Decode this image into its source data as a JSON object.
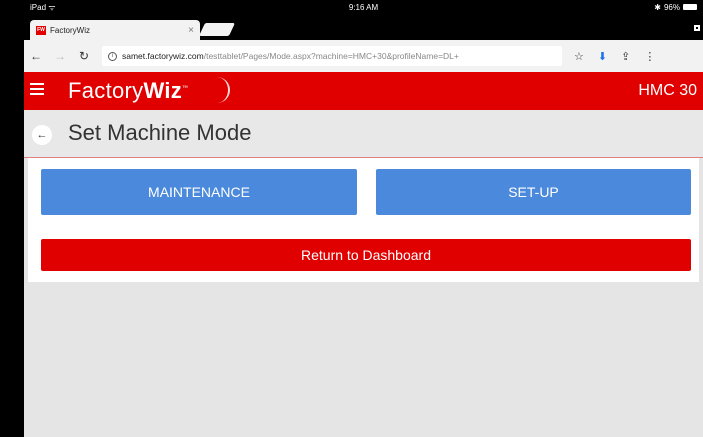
{
  "statusbar": {
    "device": "iPad",
    "wifi_icon": "wifi-icon",
    "time": "9:16 AM",
    "battery": "96%"
  },
  "browser": {
    "tab_title": "FactoryWiz",
    "favicon_text": "FW",
    "tab_close": "×",
    "url_host": "samet.factorywiz.com",
    "url_path": "/testtablet/Pages/Mode.aspx?machine=HMC+30&profileName=DL+"
  },
  "app": {
    "logo_prefix": "Factory",
    "logo_bold": "Wiz",
    "logo_tm": "™",
    "machine": "HMC 30",
    "accent": "#e00000"
  },
  "page": {
    "title": "Set Machine Mode",
    "buttons": {
      "maintenance": "MAINTENANCE",
      "setup": "SET-UP",
      "return": "Return to Dashboard"
    },
    "blue": "#4a89dc"
  }
}
